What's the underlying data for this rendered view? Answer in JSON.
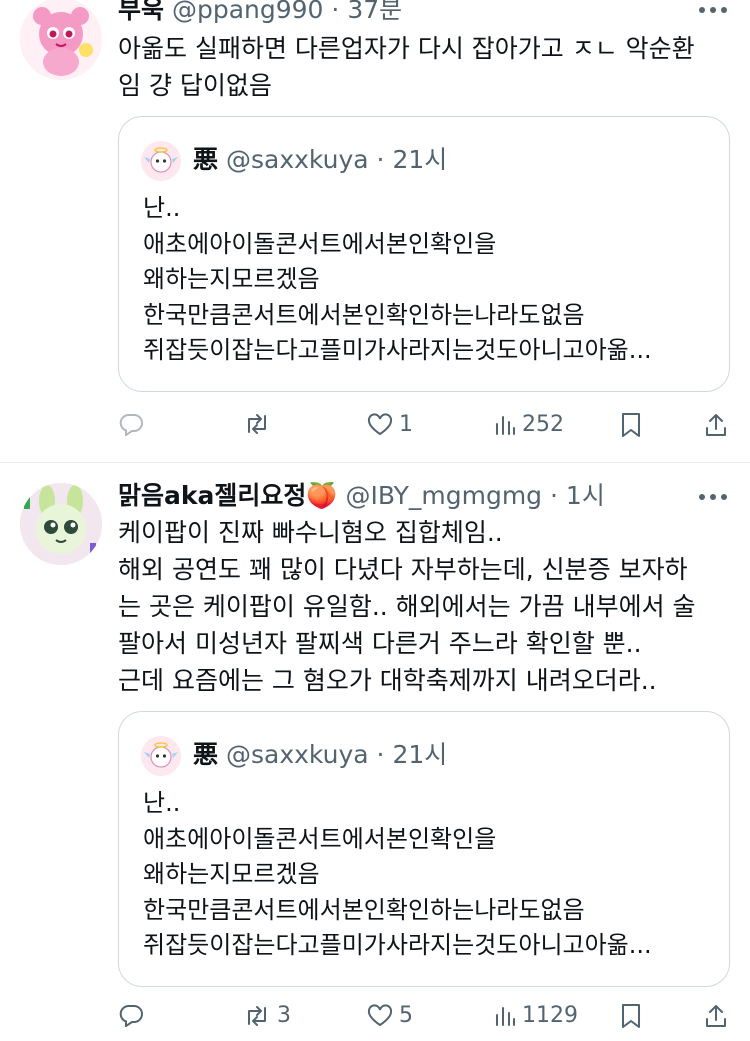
{
  "tweets": [
    {
      "display_name": "부욱",
      "handle": "@ppang990",
      "separator": "·",
      "time": "37분",
      "more_icon": "more-horizontal-icon",
      "text_lines": [
        "아옮도 실패하면 다른업자가 다시 잡아가고 ㅈㄴ 악순환",
        "임 걍 답이없음"
      ],
      "quote": {
        "display_name": "悪",
        "handle": "@saxxkuya",
        "separator": "·",
        "time": "21시",
        "text_lines": [
          "난..",
          "애초에아이돌콘서트에서본인확인을",
          "왜하는지모르겠음",
          "한국만큼콘서트에서본인확인하는나라도없음",
          "쥐잡듯이잡는다고플미가사라지는것도아니고아옮..."
        ]
      },
      "actions": {
        "replies": "",
        "retweets": "",
        "likes": "1",
        "views": "252"
      }
    },
    {
      "display_name": "맑음aka젤리요정🍑",
      "handle": "@IBY_mgmgmg",
      "separator": "·",
      "time": "1시",
      "more_icon": "more-horizontal-icon",
      "text_lines": [
        "케이팝이 진짜 빠수니혐오 집합체임..",
        "해외 공연도 꽤 많이 다녔다 자부하는데, 신분증 보자하",
        "는 곳은 케이팝이 유일함.. 해외에서는 가끔 내부에서 술",
        "팔아서 미성년자 팔찌색 다른거 주느라 확인할 뿐..",
        "근데 요즘에는 그 혐오가 대학축제까지 내려오더라.."
      ],
      "quote": {
        "display_name": "悪",
        "handle": "@saxxkuya",
        "separator": "·",
        "time": "21시",
        "text_lines": [
          "난..",
          "애초에아이돌콘서트에서본인확인을",
          "왜하는지모르겠음",
          "한국만큼콘서트에서본인확인하는나라도없음",
          "쥐잡듯이잡는다고플미가사라지는것도아니고아옮..."
        ]
      },
      "actions": {
        "replies": "",
        "retweets": "3",
        "likes": "5",
        "views": "1129"
      }
    }
  ],
  "colors": {
    "text": "#0f1419",
    "secondary": "#536471",
    "border": "#cfd9de",
    "divider": "#e6ecf0"
  }
}
